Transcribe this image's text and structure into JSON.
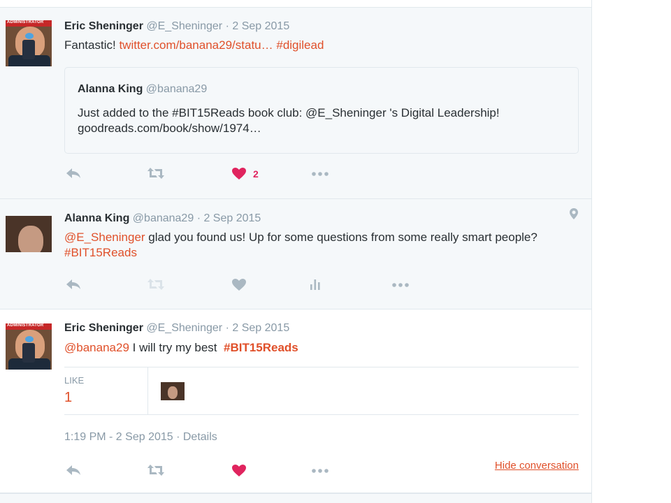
{
  "tweets": [
    {
      "name": "Eric Sheninger",
      "handle": "@E_Sheninger",
      "meta": "· 2 Sep 2015",
      "text_prefix": "Fantastic!",
      "text_link": "twitter.com/banana29/statu…",
      "text_hashtag": "#digilead",
      "avatar_banner": "ADMINISTRATOR",
      "quote": {
        "name": "Alanna King",
        "handle": "@banana29",
        "text": "Just added to the #BIT15Reads book club: @E_Sheninger 's Digital Leadership! goodreads.com/book/show/1974…"
      },
      "like_count": "2"
    },
    {
      "name": "Alanna King",
      "handle": "@banana29",
      "meta": "· 2 Sep 2015",
      "mention": "@E_Sheninger",
      "text_body": " glad you found us! Up for some questions from some really smart people? ",
      "hashtag": "#BIT15Reads"
    },
    {
      "name": "Eric Sheninger",
      "handle": "@E_Sheninger",
      "meta": "· 2 Sep 2015",
      "mention": "@banana29",
      "text_body": " I will try my best  ",
      "hashtag": "#BIT15Reads",
      "avatar_banner": "ADMINISTRATOR",
      "like_label": "LIKE",
      "like_value": "1",
      "timestamp": "1:19 PM - 2 Sep 2015 · Details",
      "hide_conversation": "Hide conversation"
    }
  ],
  "icons": {
    "reply": "reply-icon",
    "retweet": "retweet-icon",
    "like": "heart-icon",
    "more": "more-icon",
    "analytics": "analytics-icon",
    "location": "location-pin-icon"
  },
  "colors": {
    "accent": "#e0502a",
    "like_red": "#e0245e",
    "muted": "#8899a6",
    "icon_grey": "#aab8c2"
  }
}
